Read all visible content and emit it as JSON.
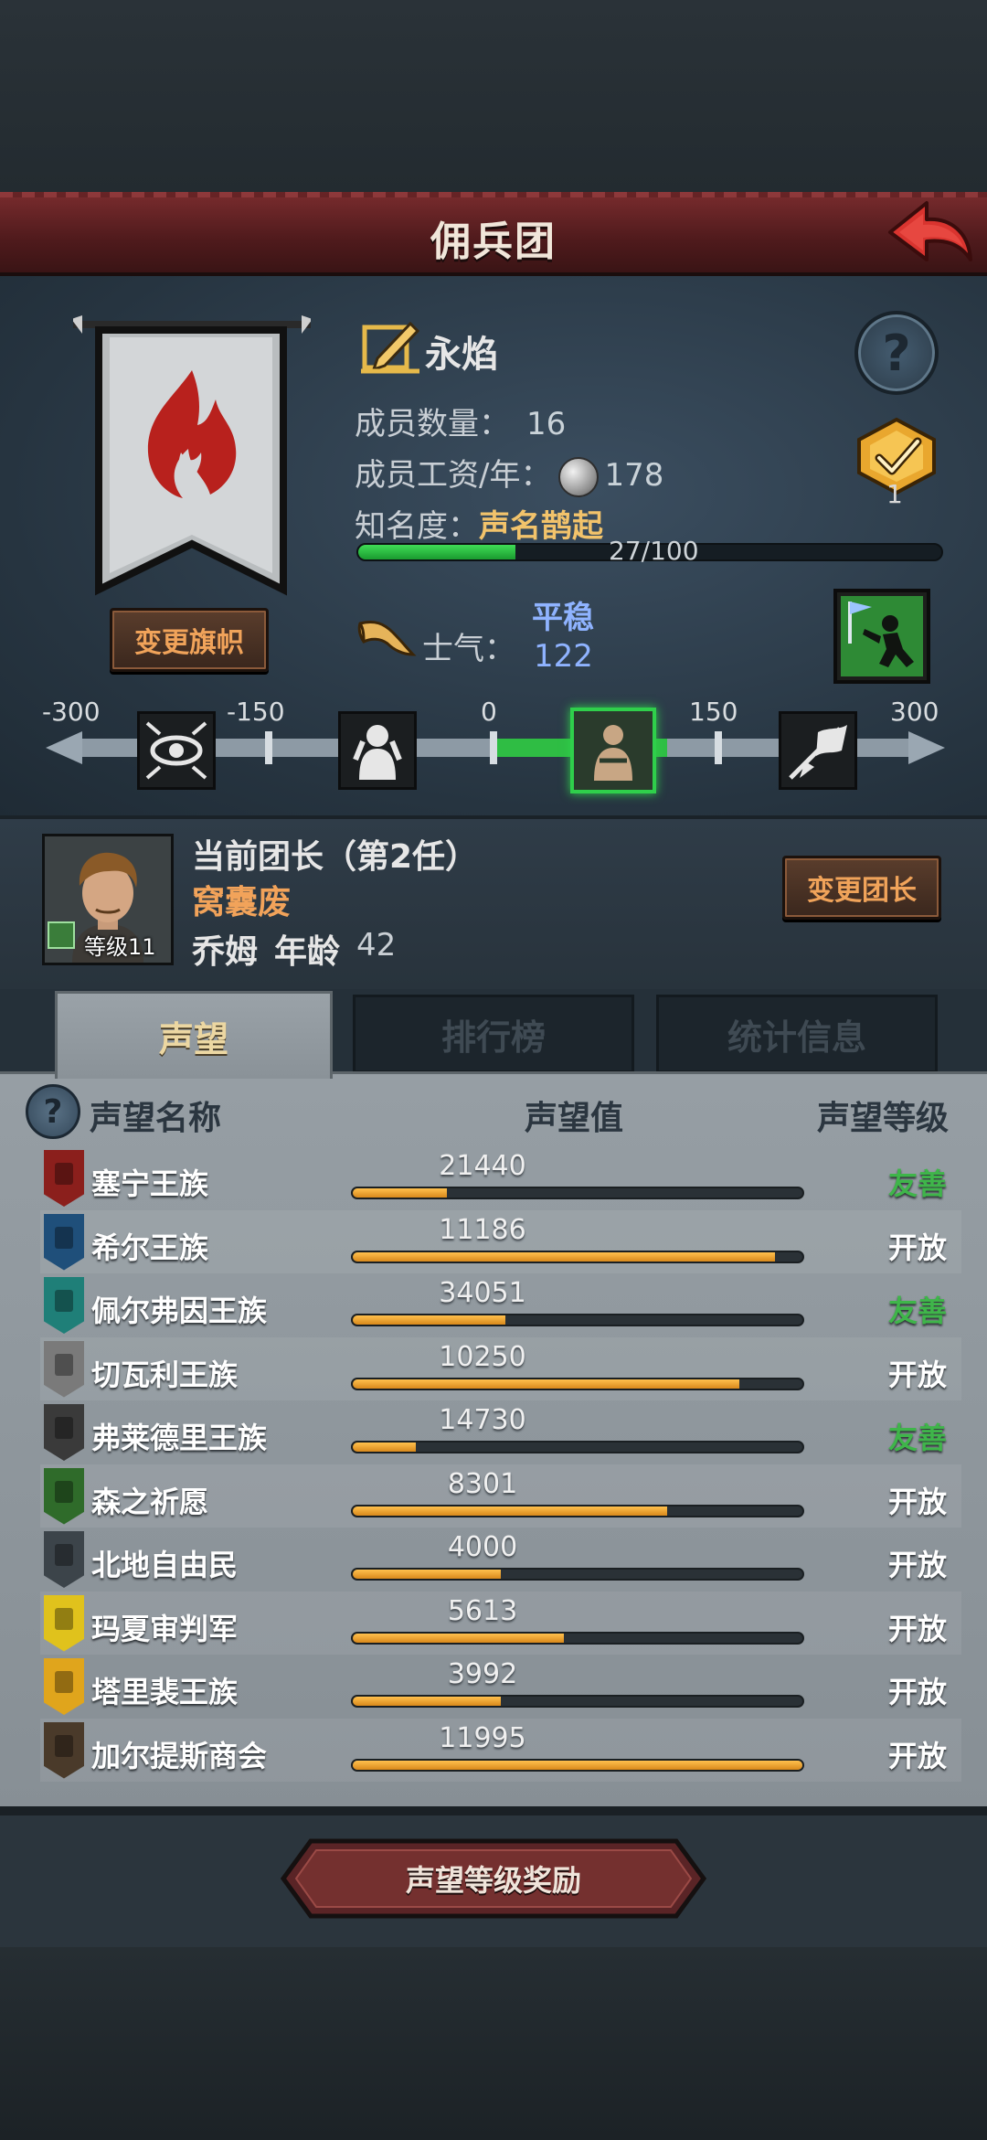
{
  "header": {
    "title": "佣兵团"
  },
  "company": {
    "name": "永焰",
    "change_flag_label": "变更旗帜",
    "members_label": "成员数量：",
    "members_value": "16",
    "wage_label": "成员工资/年：",
    "wage_value": "178",
    "fame_label": "知名度：",
    "fame_value": "声名鹊起",
    "fame_progress_text": "27/100",
    "fame_progress": 0.27,
    "badge_count": "1"
  },
  "morale": {
    "label": "士气：",
    "state": "平稳",
    "value": "122",
    "scale_labels": [
      "-300",
      "-150",
      "0",
      "150",
      "300"
    ]
  },
  "leader": {
    "title": "当前团长（第2任）",
    "trait": "窝囊废",
    "name": "乔姆",
    "age_label": "年龄",
    "age": "42",
    "level_label": "等级11",
    "change_leader_label": "变更团长"
  },
  "tabs": [
    {
      "label": "声望",
      "active": true
    },
    {
      "label": "排行榜",
      "active": false
    },
    {
      "label": "统计信息",
      "active": false
    }
  ],
  "reputation": {
    "headers": {
      "name": "声望名称",
      "value": "声望值",
      "level": "声望等级"
    },
    "rows": [
      {
        "name": "塞宁王族",
        "value": "21440",
        "progress": 0.21,
        "level": "友善",
        "level_color": "#3fb54a",
        "emblem": "#8b1f1c"
      },
      {
        "name": "希尔王族",
        "value": "11186",
        "progress": 0.94,
        "level": "开放",
        "level_color": "#ffffff",
        "emblem": "#1f4f7a"
      },
      {
        "name": "佩尔弗因王族",
        "value": "34051",
        "progress": 0.34,
        "level": "友善",
        "level_color": "#3fb54a",
        "emblem": "#1f7f78"
      },
      {
        "name": "切瓦利王族",
        "value": "10250",
        "progress": 0.86,
        "level": "开放",
        "level_color": "#ffffff",
        "emblem": "#7a7a7a"
      },
      {
        "name": "弗莱德里王族",
        "value": "14730",
        "progress": 0.14,
        "level": "友善",
        "level_color": "#3fb54a",
        "emblem": "#3a3a3a"
      },
      {
        "name": "森之祈愿",
        "value": "8301",
        "progress": 0.7,
        "level": "开放",
        "level_color": "#ffffff",
        "emblem": "#2f6b2a"
      },
      {
        "name": "北地自由民",
        "value": "4000",
        "progress": 0.33,
        "level": "开放",
        "level_color": "#ffffff",
        "emblem": "#3c444a"
      },
      {
        "name": "玛夏审判军",
        "value": "5613",
        "progress": 0.47,
        "level": "开放",
        "level_color": "#ffffff",
        "emblem": "#e0c21c"
      },
      {
        "name": "塔里裴王族",
        "value": "3992",
        "progress": 0.33,
        "level": "开放",
        "level_color": "#ffffff",
        "emblem": "#e0a51c"
      },
      {
        "name": "加尔提斯商会",
        "value": "11995",
        "progress": 1.0,
        "level": "开放",
        "level_color": "#ffffff",
        "emblem": "#4a3a2a"
      }
    ]
  },
  "reward_button_label": "声望等级奖励",
  "colors": {
    "accent_orange": "#f0a35a",
    "friendly_green": "#3fb54a",
    "morale_blue": "#8fb3ff",
    "header_red": "#7a2c2e"
  }
}
